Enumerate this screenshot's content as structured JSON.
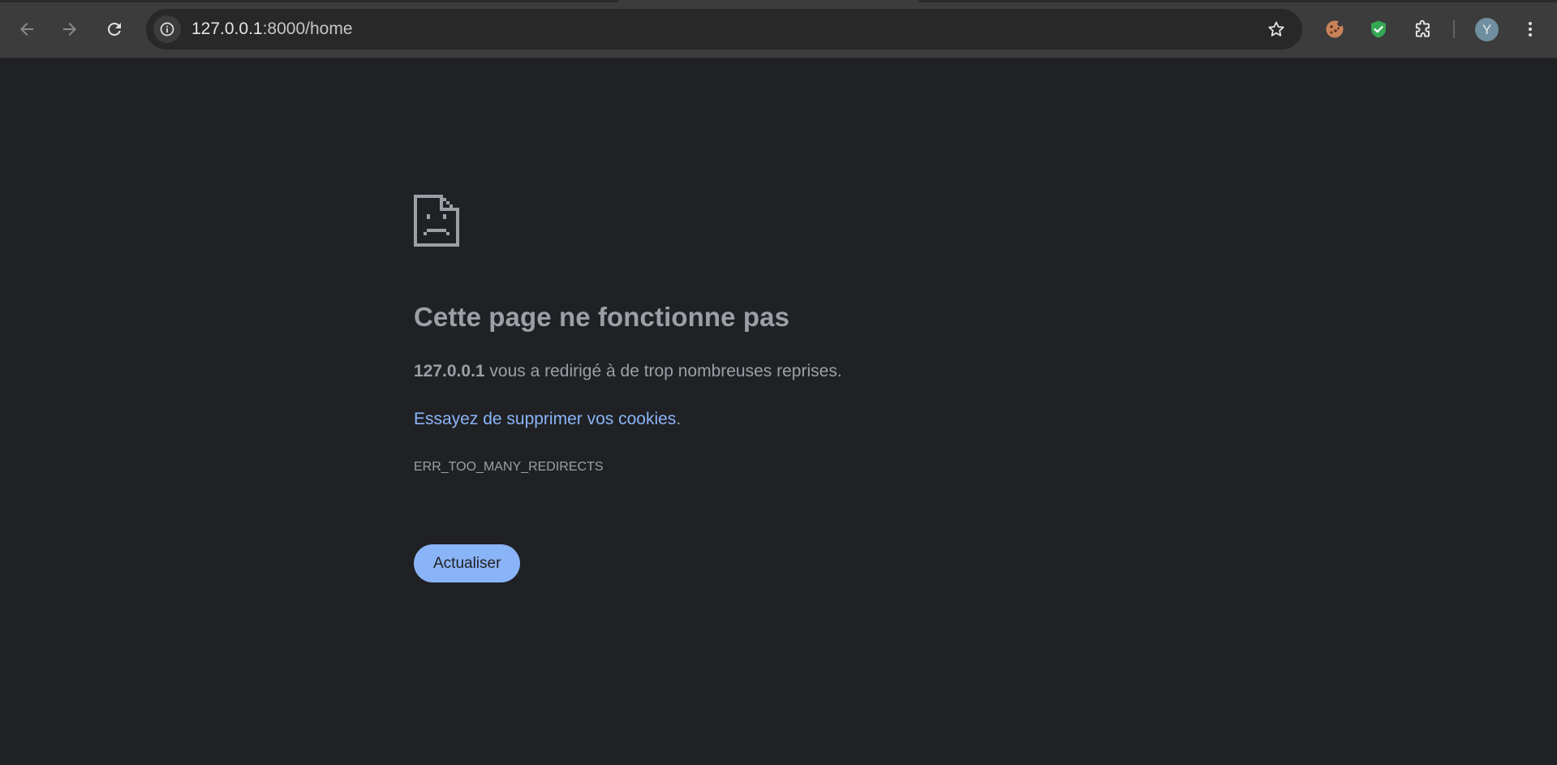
{
  "browser": {
    "url_host": "127.0.0.1",
    "url_rest": ":8000/home",
    "avatar_initial": "Y",
    "icons": {
      "back": "back-arrow-icon",
      "forward": "forward-arrow-icon",
      "reload": "reload-icon",
      "site_info": "info-icon",
      "bookmark": "star-icon",
      "cookie_ext": "cookie-icon",
      "shield_ext": "shield-check-icon",
      "extensions": "puzzle-icon",
      "menu": "kebab-menu-icon"
    },
    "colors": {
      "toolbar": "#3c3c3c",
      "omnibox": "#282828",
      "shield": "#34a853",
      "avatar": "#6f8fa0"
    }
  },
  "error_page": {
    "icon": "sad-page-icon",
    "headline": "Cette page ne fonctionne pas",
    "desc_host": "127.0.0.1",
    "desc_text": " vous a redirigé à de trop nombreuses reprises.",
    "suggestion_link": "Essayez de supprimer vos cookies",
    "suggestion_end": ".",
    "error_code": "ERR_TOO_MANY_REDIRECTS",
    "reload_label": "Actualiser",
    "colors": {
      "background": "#202124",
      "text": "#9aa0a6",
      "link": "#8ab4f8",
      "button": "#8ab4f8"
    }
  }
}
